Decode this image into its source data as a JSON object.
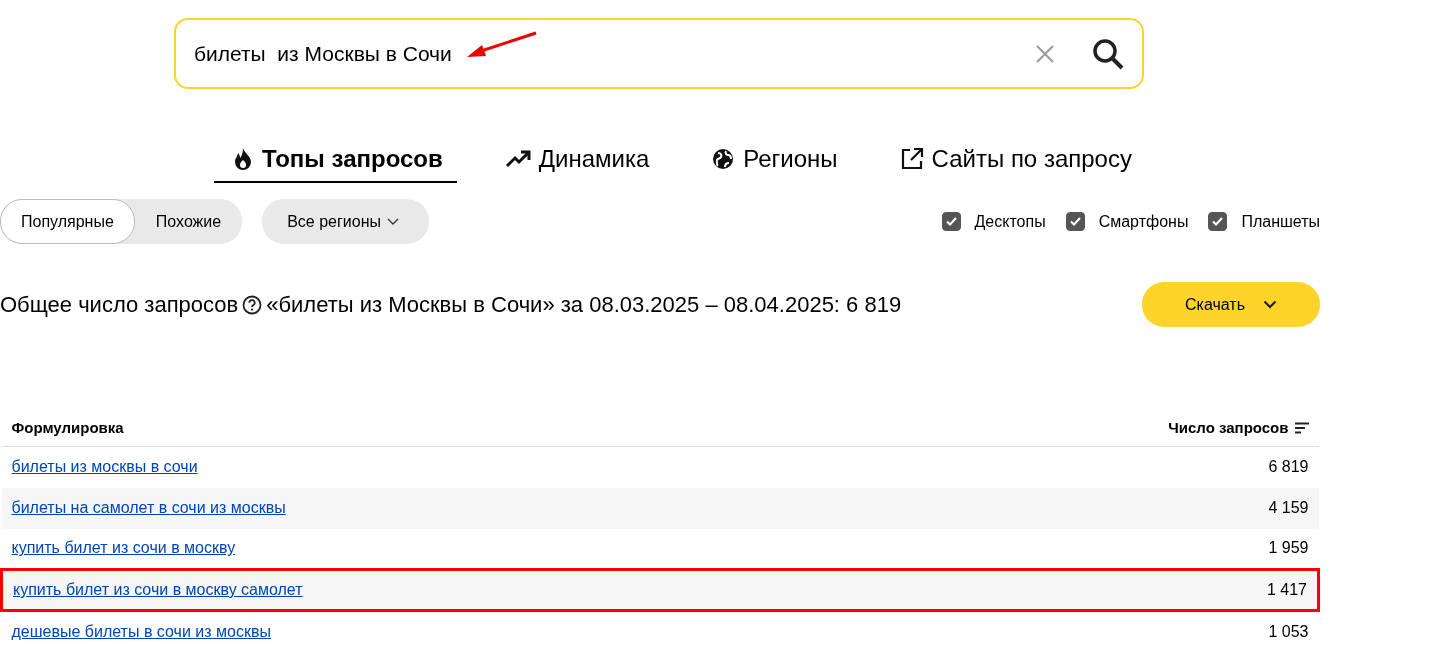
{
  "search": {
    "value": "билеты  из Москвы в Сочи"
  },
  "tabs": [
    {
      "label": "Топы запросов",
      "kind": "fire",
      "selected": true
    },
    {
      "label": "Динамика",
      "kind": "trend",
      "selected": false
    },
    {
      "label": "Регионы",
      "kind": "globe",
      "selected": false
    },
    {
      "label": "Сайты по запросу",
      "kind": "external",
      "selected": false
    }
  ],
  "modes": [
    {
      "label": "Популярные",
      "selected": true
    },
    {
      "label": "Похожие",
      "selected": false
    }
  ],
  "region_dropdown": {
    "label": "Все регионы"
  },
  "devices": [
    {
      "label": "Десктопы",
      "checked": true
    },
    {
      "label": "Смартфоны",
      "checked": true
    },
    {
      "label": "Планшеты",
      "checked": true
    }
  ],
  "summary": {
    "label": "Общее число запросов",
    "text": "«билеты из Москвы в Сочи» за 08.03.2025 – 08.04.2025: 6 819"
  },
  "download_button": {
    "label": "Скачать"
  },
  "table": {
    "columns": [
      "Формулировка",
      "Число запросов"
    ],
    "rows": [
      {
        "phrase": "билеты из москвы в сочи",
        "count": "6 819",
        "highlighted": false
      },
      {
        "phrase": "билеты на самолет в сочи из москвы",
        "count": "4 159",
        "highlighted": false
      },
      {
        "phrase": "купить билет из сочи в москву",
        "count": "1 959",
        "highlighted": false
      },
      {
        "phrase": "купить билет из сочи в москву самолет",
        "count": "1 417",
        "highlighted": true
      },
      {
        "phrase": "дешевые билеты в сочи из москвы",
        "count": "1 053",
        "highlighted": false
      }
    ]
  }
}
